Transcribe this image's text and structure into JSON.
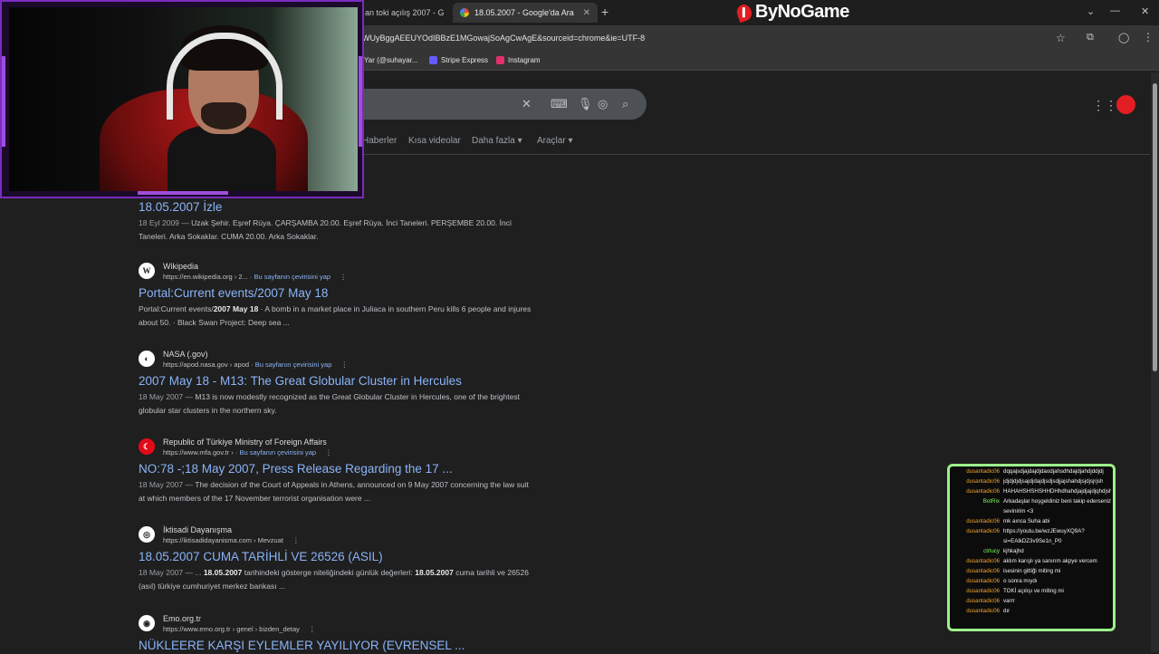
{
  "browser": {
    "tabs": [
      {
        "label": "an toki açılış 2007 - G",
        "active": false
      },
      {
        "label": "18.05.2007 - Google'da Ara",
        "active": true
      }
    ],
    "new_tab": "+",
    "close": "✕",
    "url": "WUyBggAEEUYOdIBBzE1MGowajSoAgCwAgE&sourceid=chrome&ie=UTF-8",
    "brand": "ByNoGame",
    "bookmarks": [
      {
        "label": "Yar (@suhayar...",
        "color": "#1d9bf0"
      },
      {
        "label": "Stripe Express",
        "color": "#635bff"
      },
      {
        "label": "Instagram",
        "color": "#e1306c"
      }
    ]
  },
  "search": {
    "filters": [
      "Haberler",
      "Kısa videolar",
      "Daha fazla ▾",
      "Araçlar ▾"
    ]
  },
  "results": [
    {
      "site": "",
      "url": "",
      "translate": "",
      "title": "18.05.2007 İzle",
      "snippet_date": "18 Eyl 2009 —",
      "snippet": "Uzak Şehir. Eşref Rüya. ÇARŞAMBA 20.00. Eşref Rüya. İnci Taneleri. PERŞEMBE 20.00. İnci Taneleri. Arka Sokaklar. CUMA 20.00. Arka Sokaklar."
    },
    {
      "icon": "W",
      "site": "Wikipedia",
      "url": "https://en.wikipedia.org › 2...",
      "translate": "Bu sayfanın çevirisini yap",
      "title": "Portal:Current events/2007 May 18",
      "snippet_pre": "Portal:Current events/",
      "snippet_bold": "2007 May 18",
      "snippet": " · A bomb in a market place in Juliaca in southern Peru kills 6 people and injures about 50. · Black Swan Project: Deep sea ..."
    },
    {
      "icon": "◐",
      "site": "NASA (.gov)",
      "url": "https://apod.nasa.gov › apod",
      "translate": "Bu sayfanın çevirisini yap",
      "title": "2007 May 18 - M13: The Great Globular Cluster in Hercules",
      "snippet_date": "18 May 2007 —",
      "snippet": "M13 is now modestly recognized as the Great Globular Cluster in Hercules, one of the brightest globular star clusters in the northern sky."
    },
    {
      "icon": "☾",
      "site": "Republic of Türkiye Ministry of Foreign Affairs",
      "url": "https://www.mfa.gov.tr ›",
      "translate": "Bu sayfanın çevirisini yap",
      "title": "NO:78 -;18 May 2007, Press Release Regarding the 17 ...",
      "snippet_date": "18 May 2007 —",
      "snippet": "The decision of the Court of Appeals in Athens, announced on 9 May 2007 concerning the law suit at which members of the 17 November terrorist organisation were ..."
    },
    {
      "icon": "◎",
      "site": "İktisadi Dayanışma",
      "url": "https://iktisadidayanisma.com › Mevzuat",
      "translate": "",
      "title": "18.05.2007 CUMA TARİHLİ VE 26526 (ASIL)",
      "snippet_date": "18 May 2007 — ...",
      "snippet_b1": "18.05.2007",
      "snippet_m1": " tarihindeki gösterge niteliğindeki günlük değerleri: ",
      "snippet_b2": "18.05.2007",
      "snippet_m2": " cuma tarihli ve 26526 (asıl) türkiye cumhuriyet merkez bankası ..."
    },
    {
      "icon": "◉",
      "site": "Emo.org.tr",
      "url": "https://www.emo.org.tr › genel › bizden_detay",
      "translate": "",
      "title": "NÜKLEERE KARŞI EYLEMLER YAYILIYOR (EVRENSEL ..."
    }
  ],
  "chat": [
    {
      "user": "dusantadic06",
      "msg": "dqqajsdjajdajdjdaodjahsdhdajdjahdjddjdj",
      "color": "#f0a030"
    },
    {
      "user": "dusantadic06",
      "msg": "jdjdjdjdjsajdjdajdjsdjsdjjajshahdjsjdjsjrjsh",
      "color": "#f0a030"
    },
    {
      "user": "dusantadic06",
      "msg": "HAHAHSHSHSHHDHhdhahdjajdjajdjqhdjshjdh",
      "color": "#f0a030"
    },
    {
      "user": "BotRix",
      "msg": "Arkadaşlar hoşgeldiniz beni takip ederseniz sevinirim <3",
      "color": "#7cfc5c",
      "wrap": true
    },
    {
      "user": "dusantadic06",
      "msg": "mk aınca Suha abi",
      "color": "#f0a030"
    },
    {
      "user": "dusantadic06",
      "msg": "https://youtu.be/wzJEwuyXQ9A?si=EAlkDZ3v9Se1n_P0",
      "color": "#f0a030",
      "wrap": true
    },
    {
      "user": "ctrlucy",
      "msg": "kjhkajhd",
      "color": "#7cfc5c"
    },
    {
      "user": "dusantadic06",
      "msg": "aklım karışlı ya sanırım akpye vercem",
      "color": "#f0a030",
      "wrap": true
    },
    {
      "user": "dusantadic06",
      "msg": "isesinin gittiği miting mi",
      "color": "#f0a030"
    },
    {
      "user": "dusantadic06",
      "msg": "o sonra mıydı",
      "color": "#f0a030"
    },
    {
      "user": "dusantadic06",
      "msg": "TOKİ açılışı ve miting mi",
      "color": "#f0a030"
    },
    {
      "user": "dusantadic06",
      "msg": "varrr",
      "color": "#f0a030"
    },
    {
      "user": "dusantadic06",
      "msg": "dır",
      "color": "#f0a030"
    }
  ]
}
